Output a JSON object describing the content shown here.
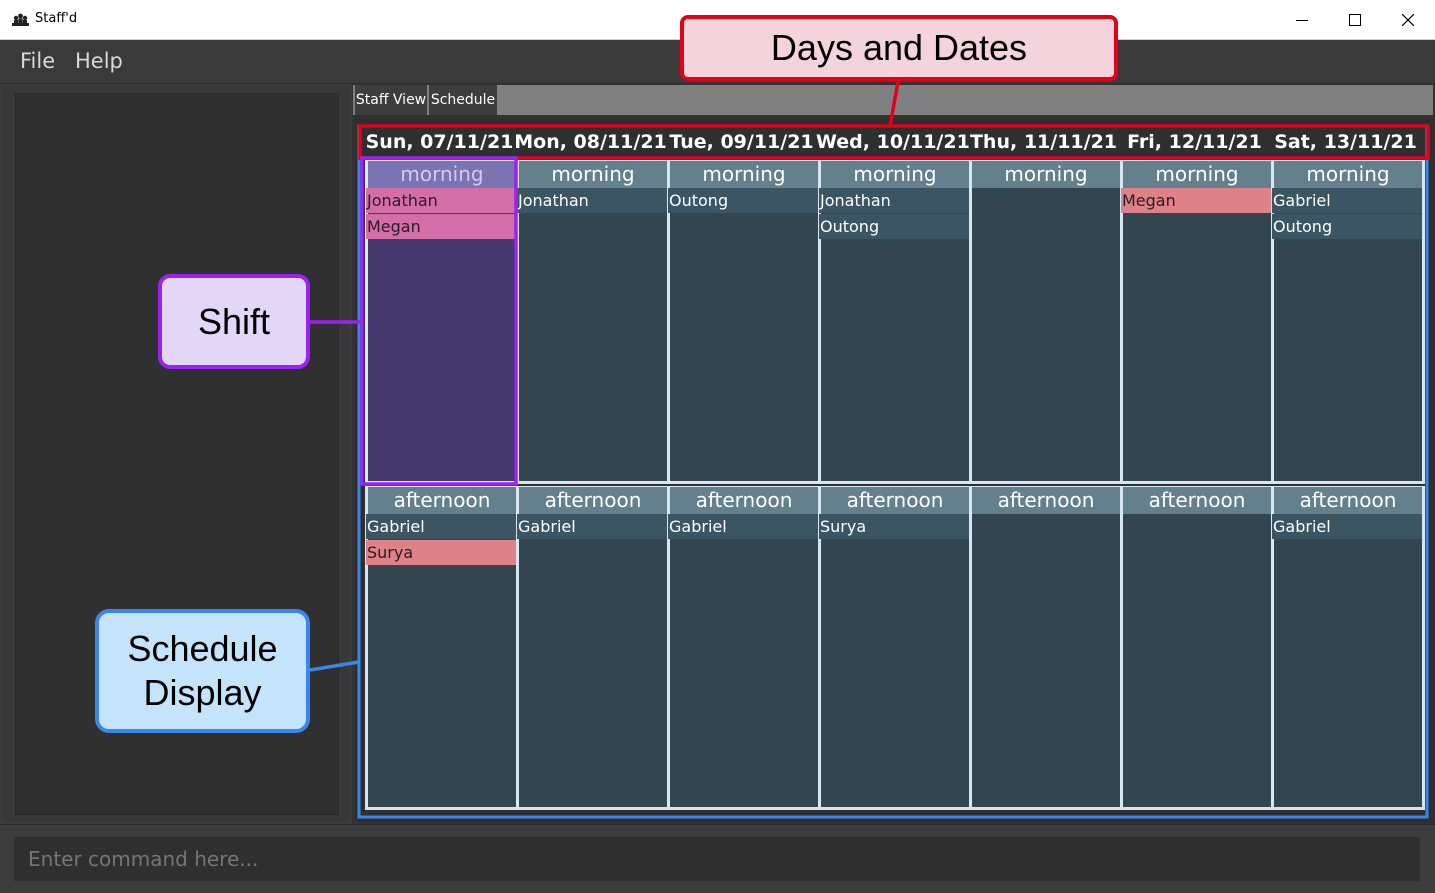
{
  "window": {
    "title": "Staff'd"
  },
  "menu": {
    "items": [
      "File",
      "Help"
    ]
  },
  "tabs": [
    {
      "label": "Staff View"
    },
    {
      "label": "Schedule"
    }
  ],
  "command": {
    "placeholder": "Enter command here..."
  },
  "annotations": {
    "days_and_dates": "Days and Dates",
    "shift": "Shift",
    "schedule_display_line1": "Schedule",
    "schedule_display_line2": "Display"
  },
  "colors": {
    "highlight_pink": "#d36ea6",
    "highlight_red": "#df8189",
    "annotation_red": "#e2001a",
    "annotation_purple": "#9b22f0",
    "annotation_blue": "#3b86e8"
  },
  "schedule": {
    "days": [
      {
        "date": "Sun, 07/11/21",
        "morning": {
          "label": "morning",
          "staff": [
            {
              "name": "Jonathan",
              "hl": "pink"
            },
            {
              "name": "Megan",
              "hl": "pink"
            }
          ]
        },
        "afternoon": {
          "label": "afternoon",
          "staff": [
            {
              "name": "Gabriel",
              "hl": ""
            },
            {
              "name": "Surya",
              "hl": "red"
            }
          ]
        }
      },
      {
        "date": "Mon, 08/11/21",
        "morning": {
          "label": "morning",
          "staff": [
            {
              "name": "Jonathan",
              "hl": ""
            }
          ]
        },
        "afternoon": {
          "label": "afternoon",
          "staff": [
            {
              "name": "Gabriel",
              "hl": ""
            }
          ]
        }
      },
      {
        "date": "Tue, 09/11/21",
        "morning": {
          "label": "morning",
          "staff": [
            {
              "name": "Outong",
              "hl": ""
            }
          ]
        },
        "afternoon": {
          "label": "afternoon",
          "staff": [
            {
              "name": "Gabriel",
              "hl": ""
            }
          ]
        }
      },
      {
        "date": "Wed, 10/11/21",
        "morning": {
          "label": "morning",
          "staff": [
            {
              "name": "Jonathan",
              "hl": ""
            },
            {
              "name": "Outong",
              "hl": ""
            }
          ]
        },
        "afternoon": {
          "label": "afternoon",
          "staff": [
            {
              "name": "Surya",
              "hl": ""
            }
          ]
        }
      },
      {
        "date": "Thu, 11/11/21",
        "morning": {
          "label": "morning",
          "staff": []
        },
        "afternoon": {
          "label": "afternoon",
          "staff": []
        }
      },
      {
        "date": "Fri, 12/11/21",
        "morning": {
          "label": "morning",
          "staff": [
            {
              "name": "Megan",
              "hl": "red"
            }
          ]
        },
        "afternoon": {
          "label": "afternoon",
          "staff": []
        }
      },
      {
        "date": "Sat, 13/11/21",
        "morning": {
          "label": "morning",
          "staff": [
            {
              "name": "Gabriel",
              "hl": ""
            },
            {
              "name": "Outong",
              "hl": ""
            }
          ]
        },
        "afternoon": {
          "label": "afternoon",
          "staff": [
            {
              "name": "Gabriel",
              "hl": ""
            }
          ]
        }
      }
    ]
  }
}
